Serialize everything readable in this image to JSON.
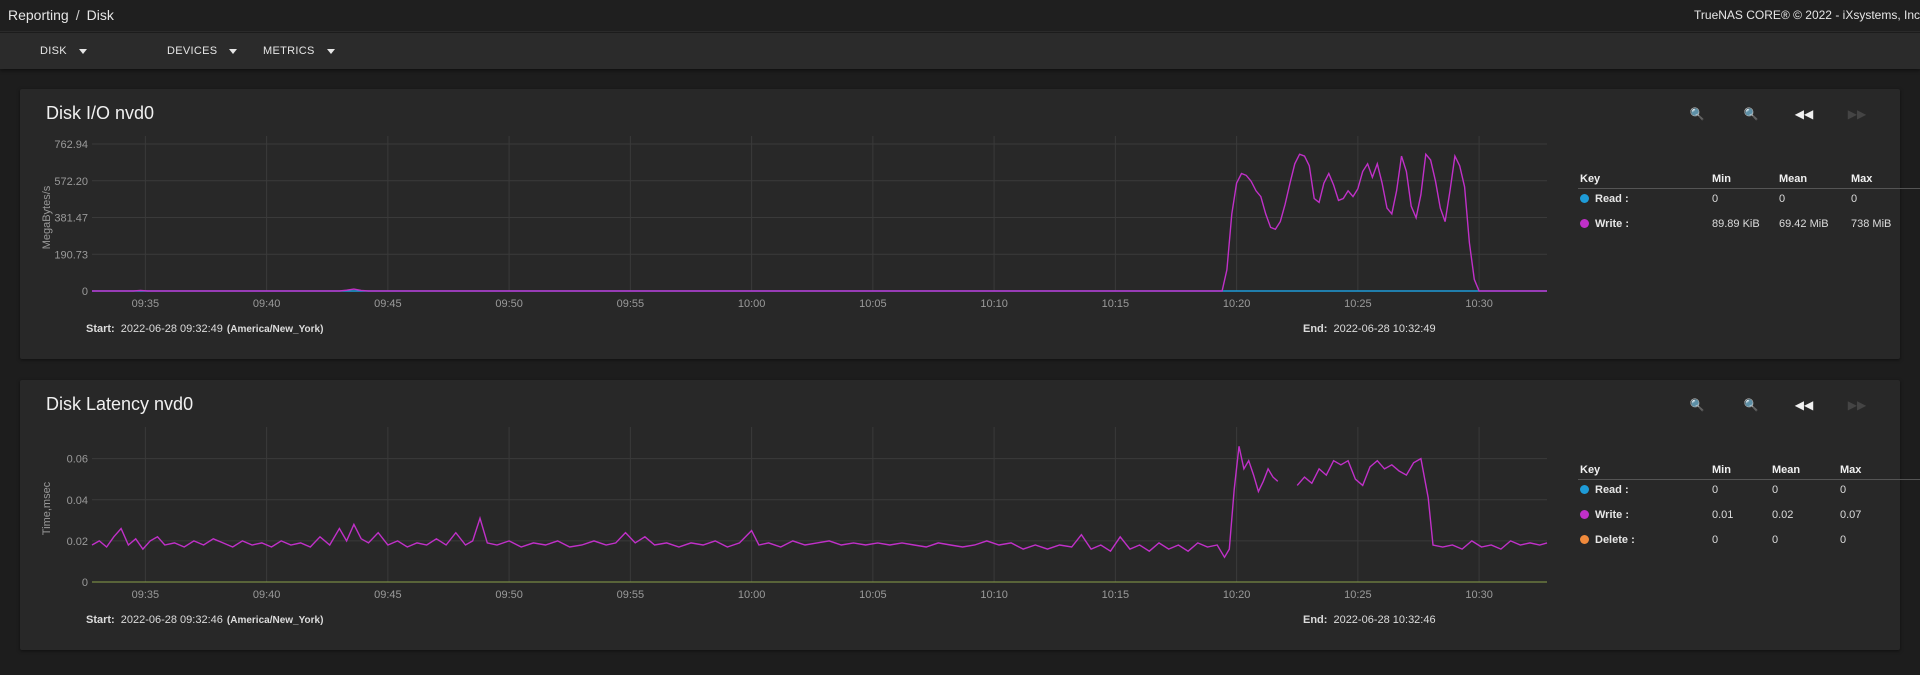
{
  "breadcrumb": {
    "section": "Reporting",
    "separator": "/",
    "current": "Disk"
  },
  "copyright": "TrueNAS CORE® © 2022 - iXsystems, Inc",
  "toolbar": {
    "disk_label": "DISK",
    "devices_label": "DEVICES",
    "metrics_label": "METRICS"
  },
  "colors": {
    "read": "#1e9bd7",
    "write": "#c030c8",
    "delete": "#f08a3c",
    "background": "#1d1d1d",
    "card": "#282828"
  },
  "icons": [
    "zoom-in-icon",
    "zoom-out-icon",
    "rewind-icon",
    "fast-forward-icon"
  ],
  "legend_headers": {
    "key": "Key",
    "min": "Min",
    "mean": "Mean",
    "max": "Max"
  },
  "charts": [
    {
      "title": "Disk I/O nvd0",
      "start_label": "Start:",
      "start": "2022-06-28 09:32:49",
      "timezone": "(America/New_York)",
      "end_label": "End:",
      "end": "2022-06-28 10:32:49",
      "legend": [
        {
          "name": "Read :",
          "min": "0",
          "mean": "0",
          "max": "0"
        },
        {
          "name": "Write :",
          "min": "89.89 KiB",
          "mean": "69.42 MiB",
          "max": "738 MiB"
        }
      ]
    },
    {
      "title": "Disk Latency nvd0",
      "start_label": "Start:",
      "start": "2022-06-28 09:32:46",
      "timezone": "(America/New_York)",
      "end_label": "End:",
      "end": "2022-06-28 10:32:46",
      "legend": [
        {
          "name": "Read :",
          "min": "0",
          "mean": "0",
          "max": "0"
        },
        {
          "name": "Write :",
          "min": "0.01",
          "mean": "0.02",
          "max": "0.07"
        },
        {
          "name": "Delete :",
          "min": "0",
          "mean": "0",
          "max": "0"
        }
      ]
    }
  ],
  "chart_data": [
    {
      "type": "line",
      "title": "Disk I/O nvd0",
      "ylabel": "MegaBytes/s",
      "y_ticks": [
        "762.94",
        "572.20",
        "381.47",
        "190.73",
        "0"
      ],
      "ylim": [
        0,
        762.94
      ],
      "x_ticks": [
        "09:35",
        "09:40",
        "09:45",
        "09:50",
        "09:55",
        "10:00",
        "10:05",
        "10:10",
        "10:15",
        "10:20",
        "10:25",
        "10:30"
      ],
      "x_tick_minutes": [
        35,
        40,
        45,
        50,
        55,
        60,
        65,
        70,
        75,
        80,
        85,
        90
      ],
      "xlim_minutes": [
        32.8,
        92.8
      ],
      "grid": true,
      "series": [
        {
          "name": "Read",
          "points": [
            [
              32.8,
              0
            ],
            [
              92.8,
              0
            ]
          ]
        },
        {
          "name": "Write",
          "points": [
            [
              32.8,
              0
            ],
            [
              34.5,
              0
            ],
            [
              34.8,
              3
            ],
            [
              35.1,
              0
            ],
            [
              43,
              0
            ],
            [
              43.3,
              4
            ],
            [
              43.6,
              10
            ],
            [
              43.9,
              3
            ],
            [
              44.2,
              0
            ],
            [
              79.4,
              0
            ],
            [
              79.6,
              110
            ],
            [
              79.8,
              400
            ],
            [
              80.0,
              560
            ],
            [
              80.2,
              610
            ],
            [
              80.4,
              600
            ],
            [
              80.6,
              570
            ],
            [
              80.8,
              520
            ],
            [
              81.0,
              490
            ],
            [
              81.2,
              400
            ],
            [
              81.4,
              330
            ],
            [
              81.6,
              320
            ],
            [
              81.8,
              360
            ],
            [
              82.0,
              450
            ],
            [
              82.2,
              560
            ],
            [
              82.4,
              660
            ],
            [
              82.6,
              710
            ],
            [
              82.8,
              700
            ],
            [
              83.0,
              650
            ],
            [
              83.2,
              480
            ],
            [
              83.4,
              460
            ],
            [
              83.6,
              560
            ],
            [
              83.8,
              610
            ],
            [
              84.0,
              550
            ],
            [
              84.2,
              470
            ],
            [
              84.4,
              480
            ],
            [
              84.6,
              520
            ],
            [
              84.8,
              490
            ],
            [
              85.0,
              530
            ],
            [
              85.2,
              620
            ],
            [
              85.4,
              660
            ],
            [
              85.6,
              590
            ],
            [
              85.8,
              660
            ],
            [
              86.0,
              560
            ],
            [
              86.2,
              430
            ],
            [
              86.4,
              400
            ],
            [
              86.6,
              520
            ],
            [
              86.8,
              700
            ],
            [
              87.0,
              620
            ],
            [
              87.2,
              440
            ],
            [
              87.4,
              380
            ],
            [
              87.6,
              500
            ],
            [
              87.8,
              710
            ],
            [
              88.0,
              680
            ],
            [
              88.2,
              570
            ],
            [
              88.4,
              430
            ],
            [
              88.6,
              360
            ],
            [
              88.8,
              520
            ],
            [
              89.0,
              700
            ],
            [
              89.2,
              650
            ],
            [
              89.4,
              540
            ],
            [
              89.6,
              250
            ],
            [
              89.8,
              60
            ],
            [
              90.0,
              0
            ],
            [
              92.8,
              0
            ]
          ]
        }
      ]
    },
    {
      "type": "line",
      "title": "Disk Latency nvd0",
      "ylabel": "Time,msec",
      "y_ticks": [
        "0.06",
        "0.04",
        "0.02",
        "0"
      ],
      "ylim": [
        0,
        0.0715
      ],
      "x_ticks": [
        "09:35",
        "09:40",
        "09:45",
        "09:50",
        "09:55",
        "10:00",
        "10:05",
        "10:10",
        "10:15",
        "10:20",
        "10:25",
        "10:30"
      ],
      "x_tick_minutes": [
        35,
        40,
        45,
        50,
        55,
        60,
        65,
        70,
        75,
        80,
        85,
        90
      ],
      "xlim_minutes": [
        32.8,
        92.8
      ],
      "grid": true,
      "series": [
        {
          "name": "Write",
          "segments": [
            [
              [
                32.8,
                0.018
              ],
              [
                33.1,
                0.02
              ],
              [
                33.4,
                0.017
              ],
              [
                33.7,
                0.022
              ],
              [
                34.0,
                0.026
              ],
              [
                34.3,
                0.018
              ],
              [
                34.6,
                0.021
              ],
              [
                34.9,
                0.016
              ],
              [
                35.2,
                0.02
              ],
              [
                35.5,
                0.022
              ],
              [
                35.8,
                0.018
              ],
              [
                36.2,
                0.019
              ],
              [
                36.6,
                0.017
              ],
              [
                37.0,
                0.02
              ],
              [
                37.4,
                0.018
              ],
              [
                37.8,
                0.021
              ],
              [
                38.2,
                0.019
              ],
              [
                38.6,
                0.017
              ],
              [
                39.0,
                0.02
              ],
              [
                39.4,
                0.018
              ],
              [
                39.8,
                0.019
              ],
              [
                40.2,
                0.017
              ],
              [
                40.6,
                0.02
              ],
              [
                41.0,
                0.018
              ],
              [
                41.4,
                0.019
              ],
              [
                41.8,
                0.017
              ],
              [
                42.2,
                0.022
              ],
              [
                42.6,
                0.018
              ],
              [
                43.0,
                0.026
              ],
              [
                43.3,
                0.02
              ],
              [
                43.6,
                0.028
              ],
              [
                43.9,
                0.021
              ],
              [
                44.2,
                0.019
              ],
              [
                44.6,
                0.024
              ],
              [
                45.0,
                0.018
              ],
              [
                45.4,
                0.02
              ],
              [
                45.8,
                0.017
              ],
              [
                46.2,
                0.019
              ],
              [
                46.6,
                0.018
              ],
              [
                47.0,
                0.021
              ],
              [
                47.4,
                0.018
              ],
              [
                47.8,
                0.024
              ],
              [
                48.2,
                0.018
              ],
              [
                48.5,
                0.02
              ],
              [
                48.8,
                0.031
              ],
              [
                49.1,
                0.019
              ],
              [
                49.5,
                0.018
              ],
              [
                50.0,
                0.02
              ],
              [
                50.5,
                0.017
              ],
              [
                51.0,
                0.019
              ],
              [
                51.5,
                0.018
              ],
              [
                52.0,
                0.02
              ],
              [
                52.5,
                0.017
              ],
              [
                53.0,
                0.018
              ],
              [
                53.5,
                0.02
              ],
              [
                54.0,
                0.018
              ],
              [
                54.4,
                0.019
              ],
              [
                54.8,
                0.024
              ],
              [
                55.2,
                0.019
              ],
              [
                55.6,
                0.022
              ],
              [
                56.0,
                0.018
              ],
              [
                56.5,
                0.019
              ],
              [
                57.0,
                0.017
              ],
              [
                57.5,
                0.019
              ],
              [
                58.0,
                0.018
              ],
              [
                58.5,
                0.02
              ],
              [
                59.0,
                0.017
              ],
              [
                59.5,
                0.019
              ],
              [
                60.0,
                0.025
              ],
              [
                60.3,
                0.018
              ],
              [
                60.7,
                0.019
              ],
              [
                61.2,
                0.017
              ],
              [
                61.7,
                0.02
              ],
              [
                62.2,
                0.018
              ],
              [
                62.7,
                0.019
              ],
              [
                63.2,
                0.02
              ],
              [
                63.7,
                0.018
              ],
              [
                64.2,
                0.019
              ],
              [
                64.7,
                0.018
              ],
              [
                65.2,
                0.019
              ],
              [
                65.7,
                0.018
              ],
              [
                66.2,
                0.019
              ],
              [
                66.7,
                0.018
              ],
              [
                67.2,
                0.017
              ],
              [
                67.7,
                0.019
              ],
              [
                68.2,
                0.018
              ],
              [
                68.7,
                0.017
              ],
              [
                69.2,
                0.018
              ],
              [
                69.7,
                0.02
              ],
              [
                70.2,
                0.018
              ],
              [
                70.7,
                0.019
              ],
              [
                71.2,
                0.016
              ],
              [
                71.7,
                0.018
              ],
              [
                72.2,
                0.016
              ],
              [
                72.7,
                0.018
              ],
              [
                73.2,
                0.017
              ],
              [
                73.6,
                0.023
              ],
              [
                74.0,
                0.016
              ],
              [
                74.4,
                0.018
              ],
              [
                74.8,
                0.015
              ],
              [
                75.2,
                0.022
              ],
              [
                75.6,
                0.016
              ],
              [
                76.0,
                0.018
              ],
              [
                76.4,
                0.015
              ],
              [
                76.8,
                0.019
              ],
              [
                77.2,
                0.016
              ],
              [
                77.6,
                0.018
              ],
              [
                78.0,
                0.015
              ],
              [
                78.4,
                0.019
              ],
              [
                78.8,
                0.017
              ],
              [
                79.2,
                0.018
              ],
              [
                79.5,
                0.012
              ],
              [
                79.7,
                0.016
              ],
              [
                79.9,
                0.045
              ],
              [
                80.1,
                0.066
              ],
              [
                80.3,
                0.055
              ],
              [
                80.5,
                0.059
              ],
              [
                80.7,
                0.052
              ],
              [
                80.9,
                0.044
              ],
              [
                81.1,
                0.049
              ],
              [
                81.3,
                0.055
              ],
              [
                81.5,
                0.051
              ],
              [
                81.7,
                0.049
              ]
            ],
            [
              [
                82.5,
                0.047
              ],
              [
                82.8,
                0.051
              ],
              [
                83.1,
                0.048
              ],
              [
                83.4,
                0.055
              ],
              [
                83.7,
                0.052
              ],
              [
                84.0,
                0.059
              ],
              [
                84.3,
                0.057
              ],
              [
                84.6,
                0.059
              ],
              [
                84.9,
                0.05
              ],
              [
                85.2,
                0.047
              ],
              [
                85.5,
                0.056
              ],
              [
                85.8,
                0.059
              ],
              [
                86.1,
                0.055
              ],
              [
                86.4,
                0.057
              ],
              [
                86.7,
                0.054
              ],
              [
                87.0,
                0.052
              ],
              [
                87.3,
                0.058
              ],
              [
                87.6,
                0.06
              ],
              [
                87.9,
                0.041
              ],
              [
                88.1,
                0.018
              ],
              [
                88.5,
                0.017
              ],
              [
                88.9,
                0.018
              ],
              [
                89.3,
                0.016
              ],
              [
                89.7,
                0.02
              ],
              [
                90.1,
                0.017
              ],
              [
                90.5,
                0.018
              ],
              [
                90.9,
                0.016
              ],
              [
                91.3,
                0.02
              ],
              [
                91.7,
                0.018
              ],
              [
                92.1,
                0.019
              ],
              [
                92.5,
                0.018
              ],
              [
                92.8,
                0.019
              ]
            ]
          ]
        }
      ]
    }
  ]
}
